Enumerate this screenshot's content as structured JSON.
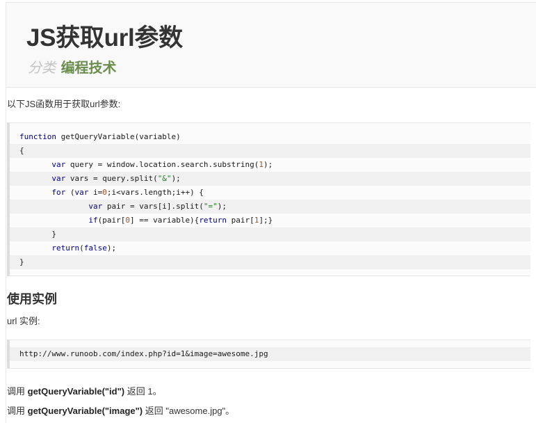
{
  "header": {
    "title": "JS获取url参数",
    "category_label": "分类",
    "category_value": "编程技术"
  },
  "intro": "以下JS函数用于获取url参数:",
  "code_block_1": {
    "lines": [
      "function getQueryVariable(variable)",
      "{",
      "       var query = window.location.search.substring(1);",
      "       var vars = query.split(\"&\");",
      "       for (var i=0;i<vars.length;i++) {",
      "               var pair = vars[i].split(\"=\");",
      "               if(pair[0] == variable){return pair[1];}",
      "       }",
      "       return(false);",
      "}"
    ]
  },
  "section": {
    "heading": "使用实例",
    "url_label": "url 实例:"
  },
  "code_block_2": {
    "lines": [
      "http://www.runoob.com/index.php?id=1&image=awesome.jpg"
    ]
  },
  "results": [
    {
      "prefix": "调用 ",
      "call": "getQueryVariable(\"id\")",
      "suffix": " 返回 1。"
    },
    {
      "prefix": "调用 ",
      "call": "getQueryVariable(\"image\")",
      "suffix": " 返回 \"awesome.jpg\"。"
    }
  ]
}
